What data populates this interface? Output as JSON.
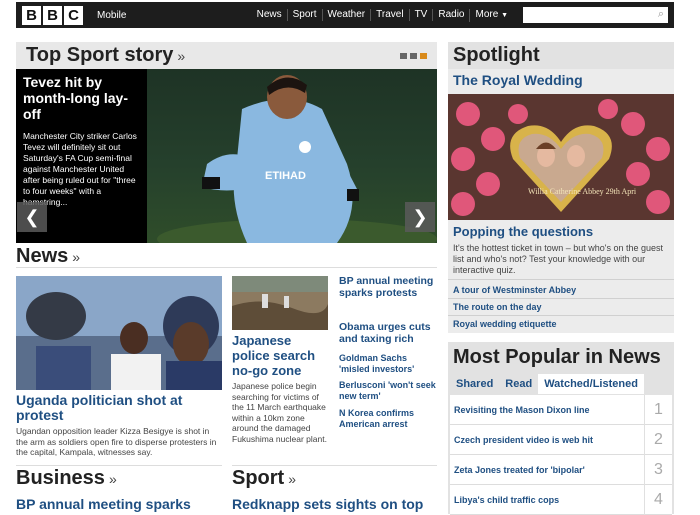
{
  "header": {
    "logo": [
      "B",
      "B",
      "C"
    ],
    "mobile_label": "Mobile",
    "nav": [
      "News",
      "Sport",
      "Weather",
      "Travel",
      "TV",
      "Radio",
      "More"
    ],
    "more_icon": "triangle-down-icon",
    "search_placeholder": "",
    "search_icon": "magnifier-icon"
  },
  "top_sport": {
    "heading": "Top Sport story",
    "chevron": "»",
    "story_title": "Tevez hit by month-long lay-off",
    "story_summary": "Manchester City striker Carlos Tevez will definitely sit out Saturday's FA Cup semi-final against Manchester United after being ruled out for \"three to four weeks\" with a hamstring...",
    "prev_icon": "chevron-left-icon",
    "next_icon": "chevron-right-icon",
    "slide_indicator": "3 dots, third highlighted"
  },
  "spotlight": {
    "heading": "Spotlight",
    "subheading": "The Royal Wedding",
    "image_caption": "Willia Catherine Abbey 29th Apri",
    "feature_title": "Popping the questions",
    "feature_desc": "It's the hottest ticket in town – but who's on the guest list and who's not? Test your knowledge with our interactive quiz.",
    "links": [
      "A tour of Westminster Abbey",
      "The route on the day",
      "Royal wedding etiquette"
    ]
  },
  "news": {
    "heading": "News",
    "chevron": "»",
    "main": {
      "title": "Uganda politician shot at protest",
      "desc": "Ugandan opposition leader Kizza Besigye is shot in the arm as soldiers open fire to disperse protesters in the capital, Kampala, witnesses say."
    },
    "second": {
      "title": "Japanese police search no-go zone",
      "desc": "Japanese police begin searching for victims of the 11 March earthquake within a 10km zone around the damaged Fukushima nuclear plant."
    },
    "links": [
      "BP annual meeting sparks protests",
      "Obama urges cuts and taxing rich",
      "Goldman Sachs 'misled investors'",
      "Berlusconi 'won't seek new term'",
      "N Korea confirms American arrest"
    ]
  },
  "business": {
    "heading": "Business",
    "chevron": "»",
    "first_link": "BP annual meeting sparks"
  },
  "sport": {
    "heading": "Sport",
    "chevron": "»",
    "first_link": "Redknapp sets sights on top"
  },
  "most_popular": {
    "heading": "Most Popular in News",
    "tabs": [
      "Shared",
      "Read",
      "Watched/Listened"
    ],
    "active_tab": "Watched/Listened",
    "items": [
      {
        "text": "Revisiting the Mason Dixon line",
        "num": "1"
      },
      {
        "text": "Czech president video is web hit",
        "num": "2"
      },
      {
        "text": "Zeta Jones treated for 'bipolar'",
        "num": "3"
      },
      {
        "text": "Libya's child traffic cops",
        "num": "4"
      }
    ]
  },
  "colors": {
    "topbar": "#1d1d1d",
    "link": "#1f4f82",
    "panel": "#e2e2e2",
    "accent_dot": "#d98a1a"
  }
}
